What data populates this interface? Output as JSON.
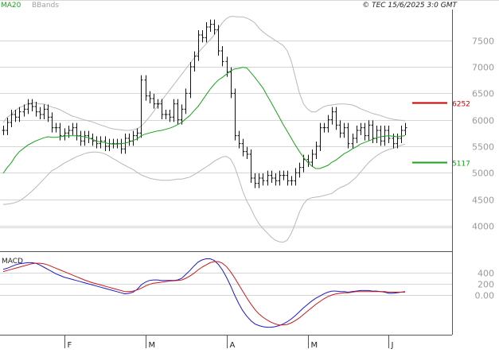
{
  "header": {
    "legend": [
      {
        "label": "MA20",
        "color": "#1aa31a"
      },
      {
        "label": "BBands",
        "color": "#a0a0a0"
      }
    ],
    "copyright": "© TEC 15/6/2025 3:0 GMT"
  },
  "macd_label": "MACD",
  "chart_data": [
    {
      "type": "candlestick",
      "title": "",
      "x_labels": [
        {
          "label": "F",
          "index": 15
        },
        {
          "label": "M",
          "index": 35
        },
        {
          "label": "A",
          "index": 55
        },
        {
          "label": "M",
          "index": 75
        },
        {
          "label": "J",
          "index": 95
        }
      ],
      "y_ticks": [
        {
          "label": "7500",
          "value": 7500
        },
        {
          "label": "7000",
          "value": 7000
        },
        {
          "label": "6500",
          "value": 6500
        },
        {
          "label": "6000",
          "value": 6000
        },
        {
          "label": "5500",
          "value": 5500
        },
        {
          "label": "5000",
          "value": 5000
        },
        {
          "label": "4500",
          "value": 4500
        },
        {
          "label": "4000",
          "value": 4000
        }
      ],
      "ylim": [
        3550,
        8050
      ],
      "grid": true,
      "levels": [
        {
          "label": "6252",
          "value": 6320,
          "color": "#cc0000"
        },
        {
          "label": "5117",
          "value": 5200,
          "color": "#1aa31a"
        }
      ],
      "series": [
        {
          "name": "Price",
          "close": [
            5800,
            5950,
            6100,
            6050,
            6150,
            6200,
            6300,
            6250,
            6150,
            6100,
            6200,
            6050,
            5850,
            5850,
            5700,
            5750,
            5800,
            5850,
            5700,
            5600,
            5700,
            5650,
            5600,
            5550,
            5600,
            5500,
            5550,
            5550,
            5550,
            5450,
            5650,
            5600,
            5700,
            5750,
            6750,
            6450,
            6400,
            6300,
            6300,
            6100,
            6100,
            6050,
            6300,
            6000,
            6200,
            6500,
            7000,
            7200,
            7600,
            7550,
            7750,
            7800,
            7700,
            7300,
            7100,
            6900,
            6500,
            5700,
            5550,
            5400,
            5350,
            4900,
            4800,
            4900,
            4850,
            4950,
            4900,
            4850,
            4950,
            4950,
            4850,
            4850,
            5000,
            5100,
            5250,
            5200,
            5350,
            5500,
            5850,
            5850,
            6000,
            6150,
            5900,
            5750,
            5850,
            5550,
            5650,
            5800,
            5850,
            5700,
            5900,
            5650,
            5800,
            5600,
            5800,
            5650,
            5550,
            5650,
            5800,
            5850
          ]
        },
        {
          "name": "MA20",
          "values": [
            4990,
            5100,
            5190,
            5310,
            5400,
            5460,
            5520,
            5560,
            5600,
            5630,
            5660,
            5680,
            5670,
            5670,
            5680,
            5690,
            5700,
            5700,
            5700,
            5690,
            5680,
            5660,
            5630,
            5600,
            5580,
            5570,
            5550,
            5540,
            5540,
            5550,
            5560,
            5580,
            5610,
            5640,
            5700,
            5730,
            5750,
            5770,
            5790,
            5800,
            5820,
            5840,
            5870,
            5910,
            5950,
            6020,
            6080,
            6170,
            6250,
            6360,
            6470,
            6580,
            6670,
            6750,
            6800,
            6860,
            6920,
            6960,
            6970,
            6990,
            6980,
            6890,
            6800,
            6700,
            6600,
            6460,
            6330,
            6190,
            6050,
            5910,
            5780,
            5650,
            5520,
            5400,
            5290,
            5200,
            5130,
            5080,
            5080,
            5110,
            5140,
            5200,
            5240,
            5300,
            5360,
            5400,
            5450,
            5490,
            5540,
            5570,
            5600,
            5630,
            5660,
            5680,
            5690,
            5700,
            5690,
            5680,
            5690,
            5700
          ]
        },
        {
          "name": "Upper Band",
          "values": [
            5950,
            6050,
            6100,
            6180,
            6230,
            6260,
            6300,
            6320,
            6320,
            6300,
            6300,
            6270,
            6240,
            6220,
            6190,
            6150,
            6110,
            6070,
            6050,
            6020,
            6000,
            5980,
            5960,
            5930,
            5900,
            5880,
            5850,
            5830,
            5820,
            5810,
            5800,
            5800,
            5810,
            5830,
            5880,
            5960,
            6050,
            6150,
            6260,
            6360,
            6460,
            6560,
            6660,
            6760,
            6860,
            6960,
            7060,
            7160,
            7260,
            7350,
            7430,
            7510,
            7600,
            7720,
            7830,
            7910,
            7950,
            7950,
            7940,
            7940,
            7920,
            7880,
            7830,
            7730,
            7660,
            7600,
            7550,
            7500,
            7450,
            7400,
            7300,
            7100,
            6800,
            6500,
            6300,
            6200,
            6150,
            6150,
            6200,
            6250,
            6270,
            6280,
            6290,
            6300,
            6300,
            6290,
            6280,
            6250,
            6210,
            6180,
            6150,
            6120,
            6100,
            6080,
            6050,
            6030,
            6010,
            6000,
            5990,
            5980
          ]
        },
        {
          "name": "Lower Band",
          "values": [
            4400,
            4410,
            4420,
            4440,
            4470,
            4520,
            4580,
            4650,
            4720,
            4800,
            4880,
            4960,
            5040,
            5080,
            5130,
            5180,
            5220,
            5260,
            5300,
            5330,
            5360,
            5380,
            5390,
            5390,
            5380,
            5360,
            5320,
            5270,
            5230,
            5180,
            5140,
            5100,
            5060,
            5010,
            4960,
            4930,
            4900,
            4880,
            4870,
            4860,
            4860,
            4860,
            4870,
            4880,
            4880,
            4900,
            4920,
            4960,
            5010,
            5060,
            5110,
            5160,
            5220,
            5260,
            5300,
            5310,
            5260,
            5120,
            4900,
            4660,
            4470,
            4330,
            4170,
            4040,
            3950,
            3870,
            3790,
            3730,
            3700,
            3690,
            3730,
            3860,
            4050,
            4260,
            4410,
            4500,
            4530,
            4540,
            4550,
            4570,
            4590,
            4610,
            4670,
            4720,
            4750,
            4790,
            4850,
            4920,
            5010,
            5100,
            5190,
            5260,
            5320,
            5370,
            5410,
            5440,
            5460,
            5490,
            5520,
            5540
          ]
        }
      ]
    },
    {
      "type": "line",
      "title": "MACD",
      "y_ticks": [
        {
          "label": "400",
          "value": 400
        },
        {
          "label": "200",
          "value": 200
        },
        {
          "label": "0.00",
          "value": 0
        }
      ],
      "ylim": [
        -700,
        700
      ],
      "grid": true,
      "series": [
        {
          "name": "MACD",
          "color": "#1a1acc",
          "values": [
            460,
            480,
            510,
            540,
            560,
            570,
            580,
            580,
            570,
            540,
            500,
            460,
            420,
            380,
            350,
            320,
            300,
            280,
            260,
            240,
            220,
            200,
            180,
            160,
            140,
            120,
            100,
            80,
            60,
            40,
            20,
            30,
            50,
            100,
            180,
            230,
            260,
            270,
            270,
            260,
            260,
            260,
            260,
            270,
            300,
            370,
            440,
            520,
            590,
            630,
            650,
            650,
            620,
            550,
            450,
            320,
            170,
            0,
            -150,
            -280,
            -380,
            -460,
            -520,
            -550,
            -570,
            -580,
            -580,
            -570,
            -550,
            -520,
            -480,
            -430,
            -370,
            -300,
            -230,
            -170,
            -110,
            -60,
            -20,
            20,
            50,
            70,
            70,
            60,
            60,
            50,
            60,
            70,
            80,
            80,
            80,
            70,
            70,
            60,
            50,
            30,
            30,
            40,
            50,
            60
          ]
        },
        {
          "name": "Signal",
          "color": "#cc1a1a",
          "values": [
            420,
            440,
            460,
            480,
            500,
            520,
            540,
            560,
            570,
            570,
            560,
            540,
            510,
            480,
            450,
            420,
            390,
            360,
            330,
            300,
            270,
            245,
            220,
            200,
            180,
            160,
            140,
            120,
            100,
            80,
            60,
            60,
            70,
            90,
            120,
            160,
            190,
            210,
            220,
            230,
            240,
            250,
            255,
            260,
            270,
            300,
            340,
            390,
            450,
            500,
            540,
            580,
            600,
            600,
            570,
            510,
            420,
            310,
            190,
            70,
            -50,
            -160,
            -260,
            -340,
            -400,
            -450,
            -490,
            -520,
            -540,
            -540,
            -530,
            -500,
            -460,
            -410,
            -350,
            -290,
            -230,
            -170,
            -120,
            -70,
            -30,
            0,
            20,
            30,
            40,
            40,
            50,
            60,
            60,
            60,
            60,
            60,
            60,
            60,
            60,
            50,
            50,
            50,
            50,
            50
          ]
        }
      ]
    }
  ]
}
